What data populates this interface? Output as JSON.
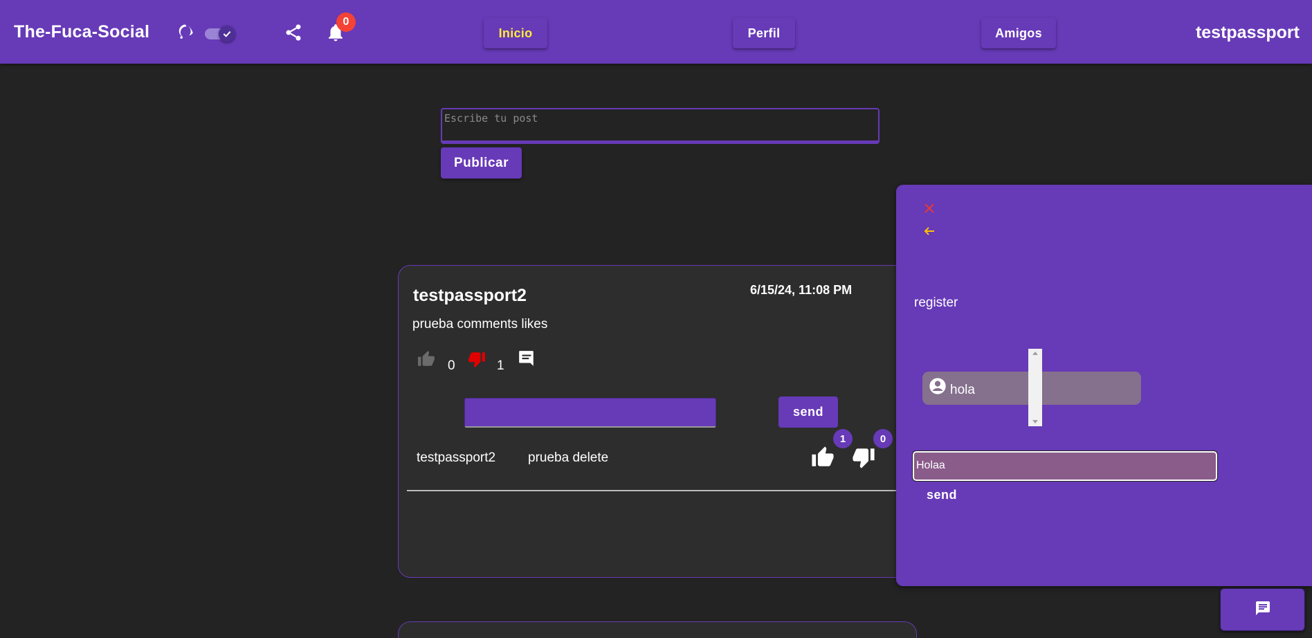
{
  "header": {
    "brand": "The-Fuca-Social",
    "notification_count": "0",
    "nav": {
      "inicio": "Inicio",
      "perfil": "Perfil",
      "amigos": "Amigos"
    },
    "username": "testpassport",
    "colors": {
      "bar": "#673ab7",
      "active_nav": "#ffeb3b",
      "badge": "#f44336"
    }
  },
  "composer": {
    "placeholder": "Escribe tu post",
    "publish_label": "Publicar"
  },
  "post": {
    "author": "testpassport2",
    "date": "6/15/24, 11:08 PM",
    "content": "prueba comments likes",
    "likes": "0",
    "dislikes": "1",
    "comment_send_label": "send",
    "comments": [
      {
        "author": "testpassport2",
        "text": "prueba delete",
        "likes": "1",
        "dislikes": "0"
      }
    ]
  },
  "chat": {
    "contact": "register",
    "messages": [
      {
        "text": "hola"
      }
    ],
    "input_value": "Holaa",
    "send_label": "send"
  },
  "icons": [
    "moon-icon",
    "toggle-switch",
    "share-icon",
    "bell-icon",
    "thumb-up-icon",
    "thumb-down-icon",
    "comment-icon",
    "close-icon",
    "arrow-back-icon",
    "account-circle-icon",
    "chat-icon"
  ]
}
